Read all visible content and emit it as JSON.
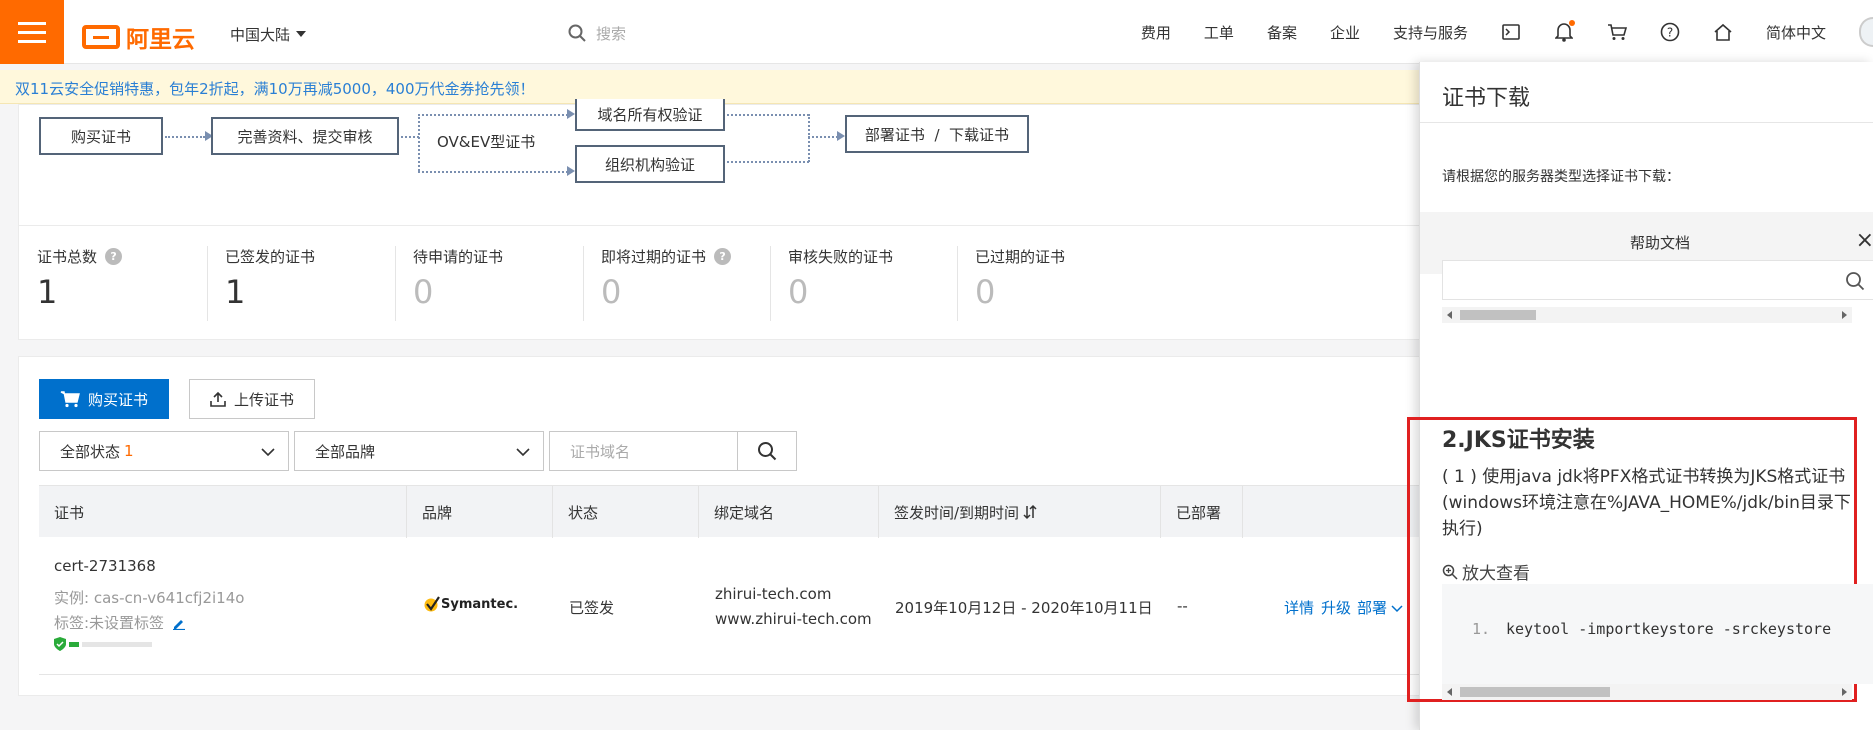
{
  "topbar": {
    "brand": "阿里云",
    "region": "中国大陆",
    "search_placeholder": "搜索",
    "nav": [
      "费用",
      "工单",
      "备案",
      "企业",
      "支持与服务"
    ],
    "language": "简体中文",
    "accent": "#ff6a00"
  },
  "promo": {
    "text": "双11云安全促销特惠，包年2折起，满10万再减5000，400万代金券抢先领！"
  },
  "flow": {
    "step1": "购买证书",
    "step2": "完善资料、提交审核",
    "branch_label": "OV&EV型证书",
    "verify_domain": "域名所有权验证",
    "verify_org": "组织机构验证",
    "final": "部署证书  /  下载证书"
  },
  "stats": [
    {
      "label": "证书总数",
      "value": "1",
      "help": "?"
    },
    {
      "label": "已签发的证书",
      "value": "1"
    },
    {
      "label": "待申请的证书",
      "value": "0"
    },
    {
      "label": "即将过期的证书",
      "value": "0",
      "help": "?"
    },
    {
      "label": "审核失败的证书",
      "value": "0"
    },
    {
      "label": "已过期的证书",
      "value": "0"
    }
  ],
  "toolbar": {
    "buy": "购买证书",
    "upload": "上传证书",
    "status_filter": "全部状态",
    "status_count": "1",
    "brand_filter": "全部品牌",
    "domain_placeholder": "证书域名"
  },
  "table": {
    "headers": [
      "证书",
      "品牌",
      "状态",
      "绑定域名",
      "签发时间/到期时间",
      "已部署"
    ],
    "row": {
      "name": "cert-2731368",
      "instance": "实例: cas-cn-v641cfj2i14o",
      "tag": "标签:未设置标签",
      "brand": "Symantec.",
      "status": "已签发",
      "domain1": "zhirui-tech.com",
      "domain2": "www.zhirui-tech.com",
      "dates": "2019年10月12日 - 2020年10月11日",
      "deployed": "--",
      "action_detail": "详情",
      "action_upgrade": "升级",
      "action_deploy": "部署"
    }
  },
  "drawer": {
    "title": "证书下载",
    "desc": "请根据您的服务器类型选择证书下载：",
    "help_title": "帮助文档",
    "close": "×",
    "jks_heading": "2.JKS证书安装",
    "jks_paragraph": "( 1 ) 使用java jdk将PFX格式证书转换为JKS格式证书(windows环境注意在%JAVA_HOME%/jdk/bin目录下执行)",
    "zoom_label": "放大查看",
    "code_line_no": "1.",
    "code": "keytool -importkeystore -srckeystore"
  }
}
